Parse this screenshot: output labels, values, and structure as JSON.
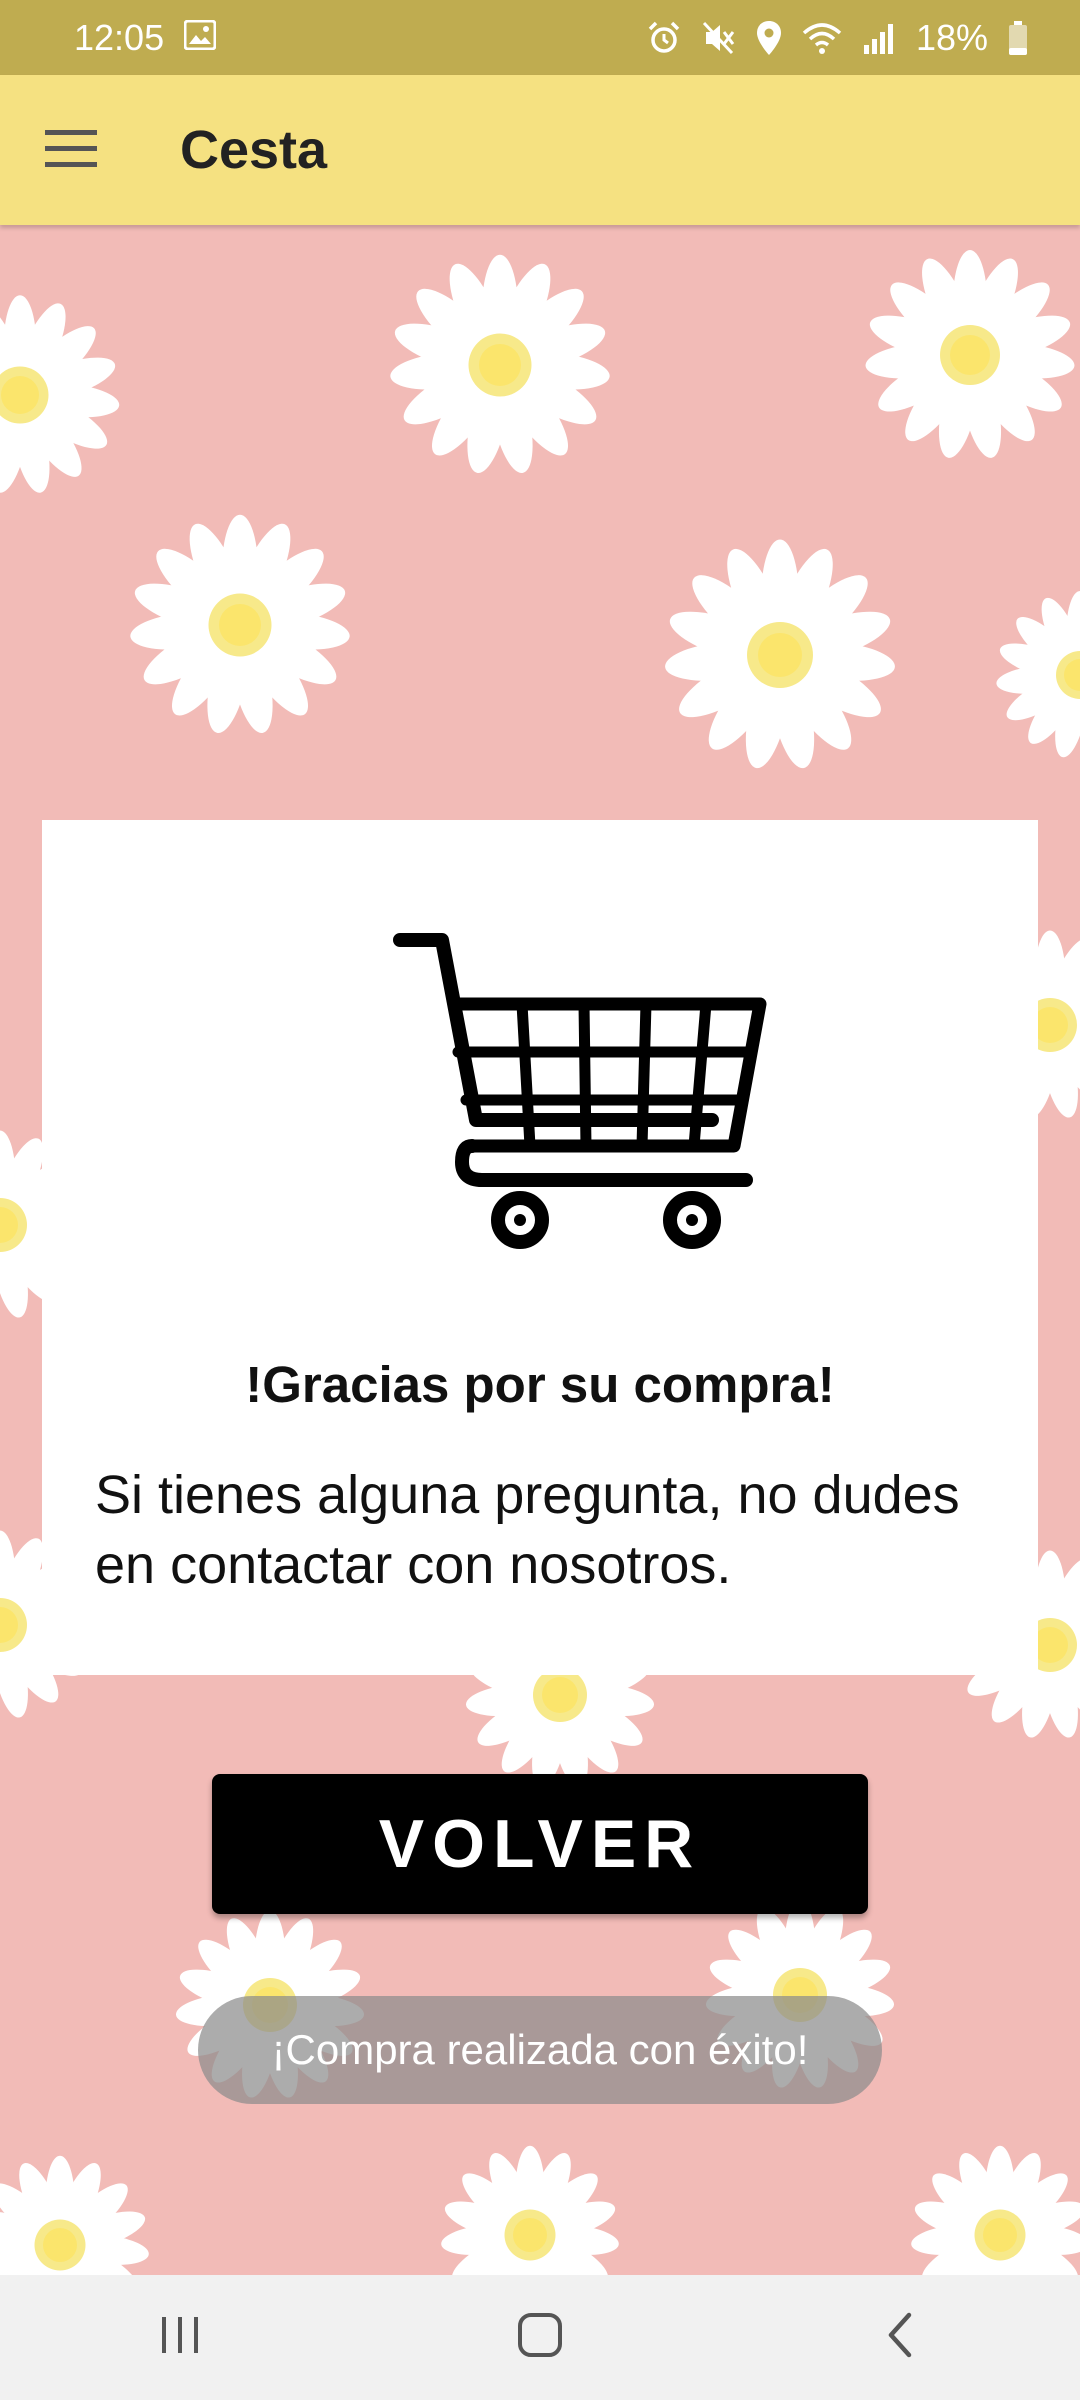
{
  "status_bar": {
    "time": "12:05",
    "battery": "18%",
    "icons": [
      "image-icon",
      "alarm-icon",
      "mute-icon",
      "location-icon",
      "wifi-icon",
      "signal-icon",
      "battery-icon"
    ]
  },
  "app_bar": {
    "title": "Cesta",
    "menu_icon": "hamburger-menu-icon",
    "background": "#f5e181"
  },
  "card": {
    "icon": "shopping-cart-icon",
    "heading": "!Gracias por su compra!",
    "message": "Si tienes alguna pregunta, no dudes en contactar con nosotros."
  },
  "button": {
    "label": "VOLVER"
  },
  "toast": {
    "text": "¡Compra realizada con éxito!"
  },
  "nav_bar": {
    "icons": [
      "recents-icon",
      "home-icon",
      "back-icon"
    ]
  },
  "colors": {
    "status_bar": "#bfac50",
    "background_pink": "#f2bbb7",
    "button": "#000000"
  }
}
